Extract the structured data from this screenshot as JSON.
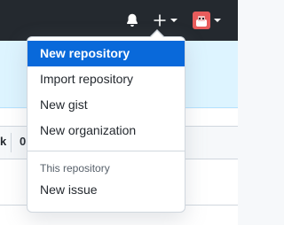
{
  "header": {
    "icons": {
      "notifications": "bell-icon",
      "create": "plus-icon",
      "user": "avatar"
    },
    "colors": {
      "background": "#24292f",
      "icon": "#ffffff",
      "avatar": "#e85c5c"
    }
  },
  "background": {
    "fragment_left": "k",
    "fragment_right": "0"
  },
  "create_menu": {
    "items": [
      {
        "label": "New repository",
        "active": true
      },
      {
        "label": "Import repository"
      },
      {
        "label": "New gist"
      },
      {
        "label": "New organization"
      }
    ],
    "section_header": "This repository",
    "section_items": [
      {
        "label": "New issue"
      }
    ],
    "colors": {
      "active_bg": "#0969da",
      "active_text": "#ffffff",
      "text": "#24292f",
      "muted": "#57606a"
    }
  }
}
